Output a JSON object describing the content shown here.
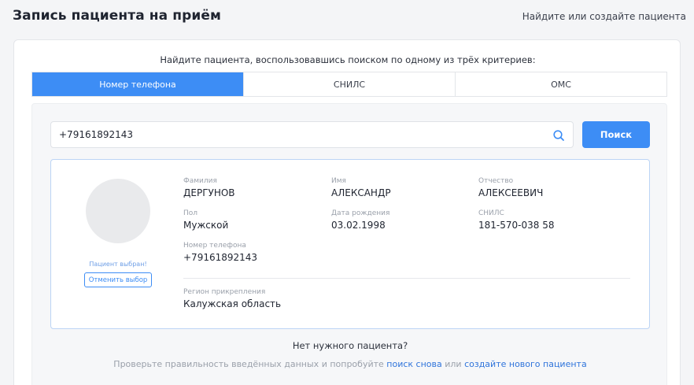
{
  "header": {
    "title": "Запись пациента на приём",
    "link": "Найдите или создайте пациента"
  },
  "search": {
    "instruction": "Найдите пациента, воспользовавшись поиском по одному из трёх критериев:",
    "tabs": [
      {
        "label": "Номер телефона",
        "active": true
      },
      {
        "label": "СНИЛС",
        "active": false
      },
      {
        "label": "ОМС",
        "active": false
      }
    ],
    "input_value": "+79161892143",
    "button_label": "Поиск"
  },
  "patient": {
    "selected_note": "Пациент выбран!",
    "cancel_label": "Отменить выбор",
    "surname_label": "Фамилия",
    "surname": "ДЕРГУНОВ",
    "name_label": "Имя",
    "name": "АЛЕКСАНДР",
    "patronymic_label": "Отчество",
    "patronymic": "АЛЕКСЕЕВИЧ",
    "sex_label": "Пол",
    "sex": "Мужской",
    "birth_label": "Дата рождения",
    "birth": "03.02.1998",
    "snils_label": "СНИЛС",
    "snils": "181-570-038 58",
    "phone_label": "Номер телефона",
    "phone": "+79161892143",
    "region_label": "Регион прикрепления",
    "region": "Калужская область"
  },
  "footer": {
    "title": "Нет нужного пациента?",
    "text_before": "Проверьте правильность введённых данных и попробуйте",
    "link_search": "поиск снова",
    "text_middle": "или",
    "link_create": "создайте нового пациента"
  },
  "colors": {
    "accent": "#3d8df5",
    "card_border": "#bcd4f5",
    "link": "#2f74db"
  },
  "icons": {
    "search": "search-icon"
  }
}
